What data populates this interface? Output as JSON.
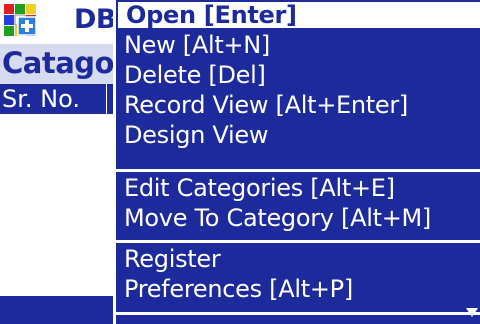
{
  "app": {
    "title": "DBW",
    "category_label": "Catagor",
    "columns": [
      "Sr. No."
    ]
  },
  "menu": {
    "items": [
      {
        "label": "Open [Enter]",
        "selected": true
      },
      {
        "label": "New [Alt+N]"
      },
      {
        "label": "Delete [Del]"
      },
      {
        "label": "Record View [Alt+Enter]"
      },
      {
        "label": "Design View"
      },
      {
        "label": "Edit Categories [Alt+E]"
      },
      {
        "label": "Move To Category [Alt+M]"
      },
      {
        "label": "Register"
      },
      {
        "label": "Preferences [Alt+P]"
      }
    ],
    "scroll_icon": "down-arrow-icon"
  },
  "colors": {
    "accent": "#1d2a9b",
    "category_bg": "#d6dbef",
    "menu_text": "#ffffff"
  }
}
